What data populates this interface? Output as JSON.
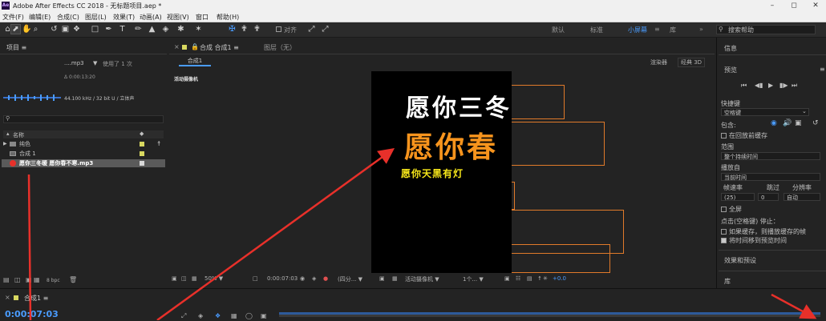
{
  "titlebar": {
    "app_icon": "Ae",
    "title": "Adobe After Effects CC 2018 - 无标题项目.aep *",
    "minimize_icon": "minimize-icon",
    "maximize_icon": "maximize-icon",
    "close_icon": "close-icon"
  },
  "menu": [
    "文件(F)",
    "编辑(E)",
    "合成(C)",
    "图层(L)",
    "效果(T)",
    "动画(A)",
    "视图(V)",
    "窗口",
    "帮助(H)"
  ],
  "toolbar": {
    "align_label": "对齐",
    "workspaces": [
      "默认",
      "标准",
      "小屏幕",
      "库"
    ],
    "active_workspace": "小屏幕",
    "search_placeholder": "搜索帮助"
  },
  "project": {
    "tab": "项目",
    "file_name": "....mp3",
    "usage": "使用了 1 次",
    "duration": "Δ 0:00:13:20",
    "audio_info": "44.100 kHz / 32 bit U / 立体声",
    "search_placeholder": "",
    "col_name": "名称",
    "items": [
      {
        "name": "纯色",
        "type": "folder",
        "color": "#d8d860"
      },
      {
        "name": "合成 1",
        "type": "comp",
        "color": "#d8d860"
      },
      {
        "name": "愿你三冬暖 愿你春不寒.mp3",
        "type": "audio",
        "color": "#d8d8d8"
      }
    ],
    "bpc": "8 bpc"
  },
  "viewer": {
    "tab_comp": "合成 合成1",
    "tab_layer": "图层（无）",
    "sub_tab": "合成1",
    "renderer": "渲染器",
    "classic3d": "经典 3D",
    "camera_label": "活动摄像机",
    "subtitle_white": "愿你三冬",
    "subtitle_orange": "愿你春",
    "subtitle_yellow": "愿你天黑有灯",
    "zoom": "50%",
    "timecode": "0:00:07:03",
    "resolution": "(四分...",
    "camera": "活动摄像机",
    "views": "1个...",
    "exposure": "+0.0"
  },
  "right": {
    "info": "信息",
    "preview": "预览",
    "shortcut_label": "快捷键",
    "shortcut_value": "空格键",
    "include_label": "包含:",
    "cache_before_play": "在回放前缓存",
    "range_label": "范围",
    "range_value": "整个持续时间",
    "play_from_label": "播放自",
    "play_from_value": "当前时间",
    "framerate_label": "帧速率",
    "skip_label": "跳过",
    "resolution_label": "分辨率",
    "framerate_value": "(25)",
    "skip_value": "0",
    "resolution_value": "自动",
    "fullscreen": "全屏",
    "stop_label": "点击(空格键) 停止：",
    "stop_opt1": "如果缓存，则播放缓存的帧",
    "stop_opt2": "将时间移到预览时间",
    "effects": "效果和预设",
    "library": "库"
  },
  "timeline": {
    "tab": "合成1",
    "timecode": "0:00:07:03"
  },
  "colors": {
    "accent": "#4a9cff",
    "subtitle_orange": "#f7941d",
    "subtitle_yellow": "#f6e61a",
    "arrow_red": "#e8302a",
    "outline_orange": "#e07a2a"
  }
}
